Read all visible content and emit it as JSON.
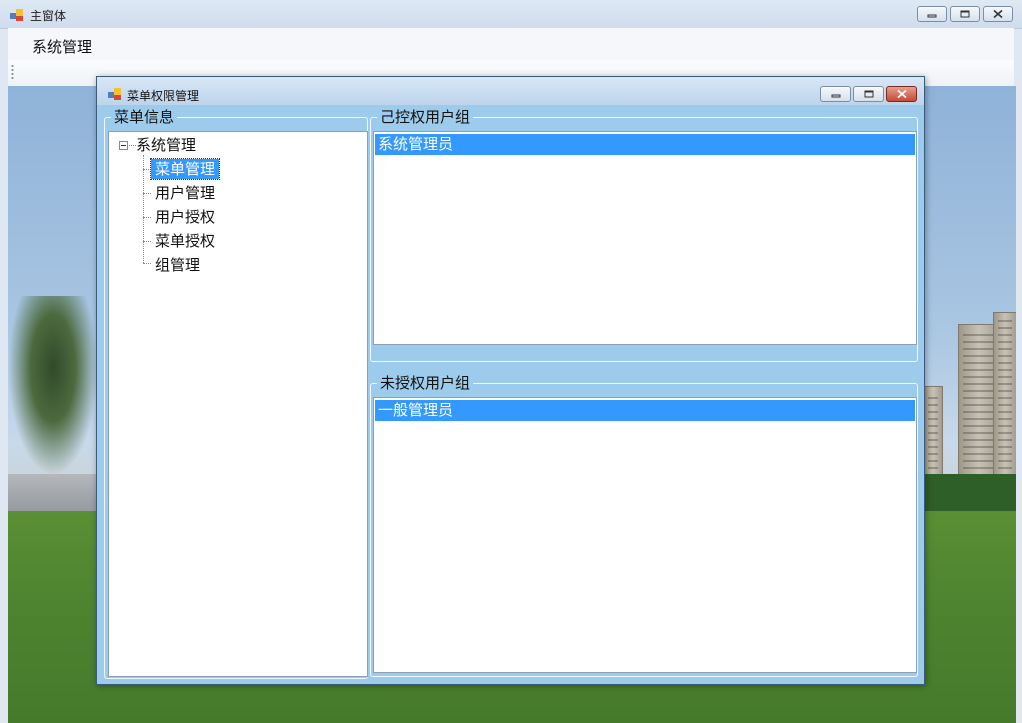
{
  "main_window": {
    "title": "主窗体",
    "menu": {
      "system_label": "系统管理"
    }
  },
  "child_window": {
    "title": "菜单权限管理",
    "menu_group": {
      "title": "菜单信息",
      "tree": {
        "root": "系统管理",
        "children": [
          "菜单管理",
          "用户管理",
          "用户授权",
          "菜单授权",
          "组管理"
        ],
        "selected_index": 0
      }
    },
    "authorized_group": {
      "title": "己控权用户组",
      "items": [
        "系统管理员"
      ]
    },
    "unauthorized_group": {
      "title": "未授权用户组",
      "items": [
        "一般管理员"
      ]
    }
  },
  "icons": {
    "app": "app-window-icon",
    "minimize": "minimize-icon",
    "maximize": "maximize-icon",
    "close": "close-icon"
  },
  "colors": {
    "selection": "#3399ff",
    "child_client": "#9ccbeb",
    "close_button": "#c64a32"
  }
}
